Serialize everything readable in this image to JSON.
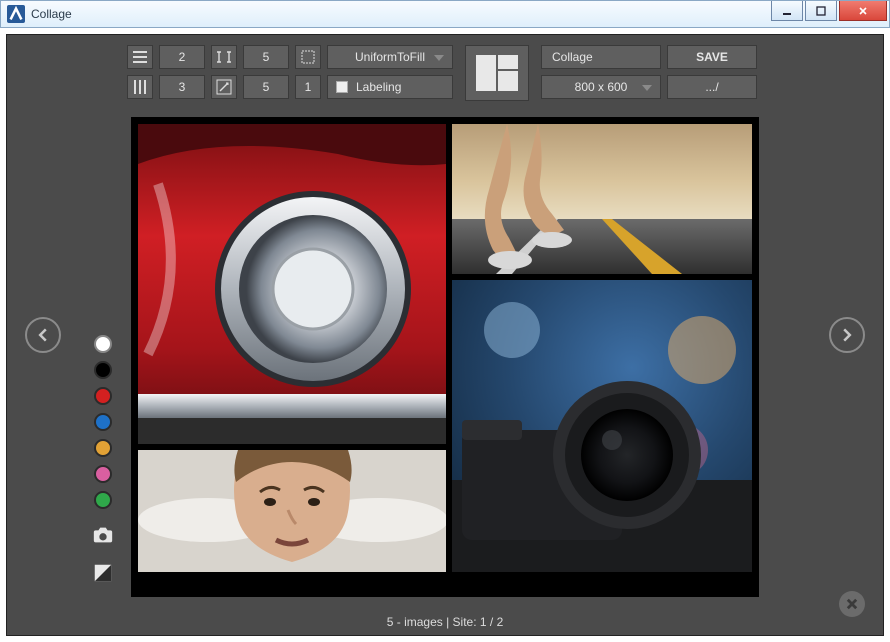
{
  "window": {
    "title": "Collage"
  },
  "toolbar": {
    "rows_value": "2",
    "cols_value": "3",
    "gap_value": "5",
    "margin_value": "5",
    "border_value": "1",
    "stretch_mode": "UniformToFill",
    "labeling_label": "Labeling",
    "filename": "Collage",
    "save_label": "SAVE",
    "size_selected": "800 x 600",
    "path_label": ".../"
  },
  "palette": {
    "colors": [
      "white",
      "black",
      "red",
      "blue",
      "orange",
      "pink",
      "green"
    ]
  },
  "status": {
    "text": "5 - images | Site: 1 / 2"
  }
}
